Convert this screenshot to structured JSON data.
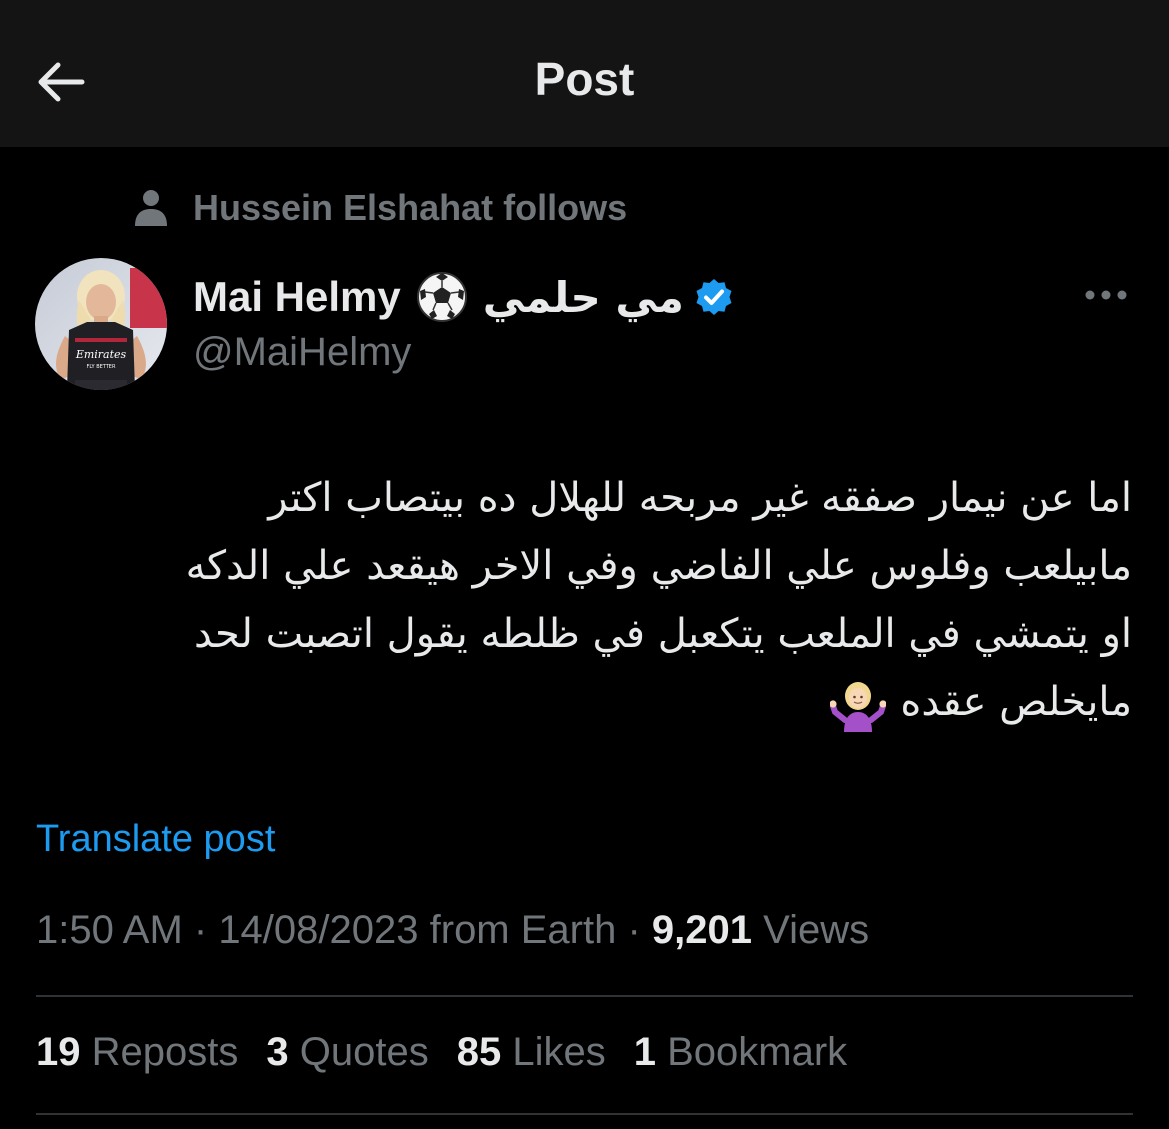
{
  "header": {
    "title": "Post",
    "back_icon": "arrow-left-icon"
  },
  "social_context": {
    "icon": "person-icon",
    "text": "Hussein Elshahat follows"
  },
  "author": {
    "display_name": "Mai Helmy",
    "emoji": "soccer-ball-icon",
    "arabic_name": "مي حلمي",
    "verified": true,
    "verified_color": "#1d9bf0",
    "handle": "@MaiHelmy"
  },
  "tweet": {
    "lines": [
      "اما عن نيمار صفقه غير مربحه للهلال ده بيتصاب اكتر",
      "مابيلعب وفلوس علي الفاضي وفي الاخر هيقعد علي الدكه",
      "او يتمشي في الملعب يتكعبل في ظلطه يقول اتصبت لحد",
      "مايخلص عقده"
    ],
    "trailing_emoji": "person-shrugging-icon"
  },
  "translate_label": "Translate post",
  "meta": {
    "time": "1:50 AM",
    "sep1": " · ",
    "date": "14/08/2023",
    "location": " from Earth",
    "sep2": " · ",
    "views_count": "9,201",
    "views_label": " Views"
  },
  "stats": [
    {
      "count": "19",
      "label": "Reposts"
    },
    {
      "count": "3",
      "label": "Quotes"
    },
    {
      "count": "85",
      "label": "Likes"
    },
    {
      "count": "1",
      "label": "Bookmark"
    }
  ],
  "colors": {
    "background": "#000000",
    "header_bg": "#141414",
    "text_primary": "#e7e9ea",
    "text_secondary": "#71767b",
    "link": "#1d9bf0",
    "divider": "#2f3336"
  }
}
